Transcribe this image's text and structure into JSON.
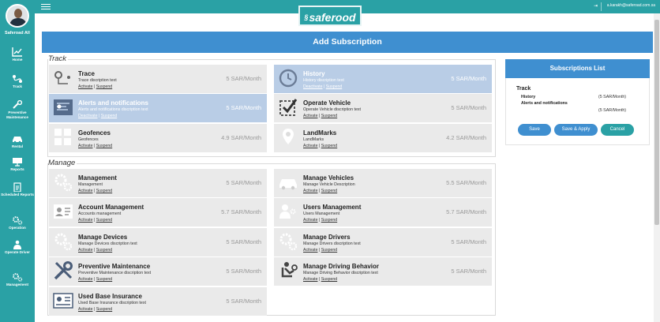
{
  "topbar": {
    "logo_text": "saferood",
    "email": "a.karakh@saferoad.com.sa",
    "user_icon": "user-icon"
  },
  "sidebar": {
    "user_name": "Saferoad All",
    "items": [
      {
        "label": "Home",
        "icon": "chart-icon"
      },
      {
        "label": "Track",
        "icon": "route-icon"
      },
      {
        "label": "Preventive Maintenance",
        "icon": "wrench-icon"
      },
      {
        "label": "Rental",
        "icon": "car-icon"
      },
      {
        "label": "Reports",
        "icon": "screen-icon"
      },
      {
        "label": "Scheduled Reports",
        "icon": "clipboard-icon"
      },
      {
        "label": "Operation",
        "icon": "gears-icon"
      },
      {
        "label": "Operate Driver",
        "icon": "driver-icon"
      },
      {
        "label": "Management",
        "icon": "gears-icon"
      }
    ]
  },
  "page": {
    "title": "Add Subscription"
  },
  "sections": {
    "track": {
      "title": "Track",
      "cards": [
        {
          "name": "Trace",
          "desc": "Trace discription text",
          "price": "5 SAR/Month",
          "link1": "Activate",
          "link2": "Suspend",
          "selected": false
        },
        {
          "name": "History",
          "desc": "History discription text",
          "price": "5 SAR/Month",
          "link1": "Deactivate",
          "link2": "Suspend",
          "selected": true
        },
        {
          "name": "Alerts and notifications",
          "desc": "Alerts and notifications discription text",
          "price": "5 SAR/Month",
          "link1": "Deactivate",
          "link2": "Suspend",
          "selected": true
        },
        {
          "name": "Operate Vehicle",
          "desc": "Operate Vehicle discription text",
          "price": "5 SAR/Month",
          "link1": "Activate",
          "link2": "Suspend",
          "selected": false
        },
        {
          "name": "Geofences",
          "desc": "Geofences",
          "price": "4.9 SAR/Month",
          "link1": "Activate",
          "link2": "Suspend",
          "selected": false
        },
        {
          "name": "LandMarks",
          "desc": "LandMarks",
          "price": "4.2 SAR/Month",
          "link1": "Activate",
          "link2": "Suspend",
          "selected": false
        }
      ]
    },
    "manage": {
      "title": "Manage",
      "cards": [
        {
          "name": "Management",
          "desc": "Management",
          "price": "5 SAR/Month",
          "link1": "Activate",
          "link2": "Suspend"
        },
        {
          "name": "Manage Vehicles",
          "desc": "Manage Vehicle Description",
          "price": "5.5 SAR/Month",
          "link1": "Activate",
          "link2": "Suspend"
        },
        {
          "name": "Account Management",
          "desc": "Accounts management",
          "price": "5.7 SAR/Month",
          "link1": "Activate",
          "link2": "Suspend"
        },
        {
          "name": "Users Management",
          "desc": "Users Management",
          "price": "5.7 SAR/Month",
          "link1": "Activate",
          "link2": "Suspend"
        },
        {
          "name": "Manage Devices",
          "desc": "Manage Devices discription text",
          "price": "5 SAR/Month",
          "link1": "Activate",
          "link2": "Suspend"
        },
        {
          "name": "Manage Drivers",
          "desc": "Manage Drivers discription text",
          "price": "5 SAR/Month",
          "link1": "Activate",
          "link2": "Suspend"
        },
        {
          "name": "Preventive Maintenance",
          "desc": "Preventive Maintenance discription text",
          "price": "5 SAR/Month",
          "link1": "Activate",
          "link2": "Suspend"
        },
        {
          "name": "Manage Driving Behavior",
          "desc": "Manage Driving Behavior discription text",
          "price": "5 SAR/Month",
          "link1": "Activate",
          "link2": "Suspend"
        },
        {
          "name": "Used Base Insurance",
          "desc": "Used Base Insurance discription text",
          "price": "5 SAR/Month",
          "link1": "Activate",
          "link2": "Suspend"
        }
      ]
    }
  },
  "subscriptions": {
    "title": "Subscriptions List",
    "group": "Track",
    "items": [
      {
        "name": "History",
        "price": "(5 SAR/Month)"
      },
      {
        "name": "Alerts and notifications",
        "price": "(5 SAR/Month)"
      }
    ],
    "buttons": {
      "save": "Save",
      "save_apply": "Save & Apply",
      "cancel": "Cancel"
    },
    "colors": {
      "save": "#3f8fd0",
      "save_apply": "#3f8fd0",
      "cancel": "#2aa1a5"
    }
  },
  "colors": {
    "sidebar": "#2aa1a5",
    "header": "#3f8fd0",
    "selected_card": "#b9cde6",
    "card": "#eaeaea"
  }
}
